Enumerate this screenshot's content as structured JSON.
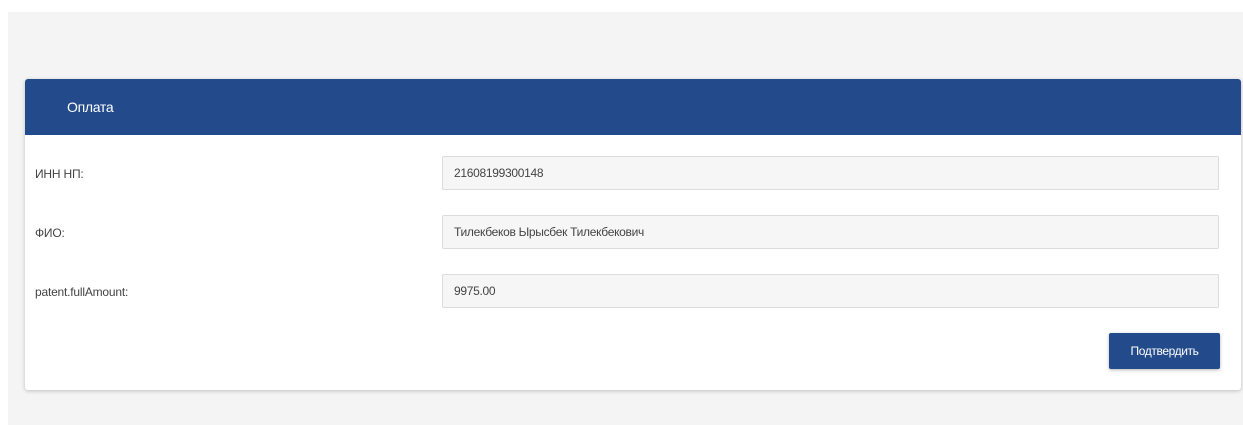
{
  "panel": {
    "title": "Оплата"
  },
  "form": {
    "fields": [
      {
        "label": "ИНН НП:",
        "value": "21608199300148"
      },
      {
        "label": "ФИО:",
        "value": "Тилекбеков Ырысбек Тилекбекович"
      },
      {
        "label": "patent.fullAmount:",
        "value": "9975.00"
      }
    ],
    "submit_label": "Подтвердить"
  },
  "colors": {
    "header_bg": "#234b8b",
    "button_bg": "#234b8b",
    "page_bg": "#f4f4f4",
    "input_bg": "#f6f6f6"
  }
}
